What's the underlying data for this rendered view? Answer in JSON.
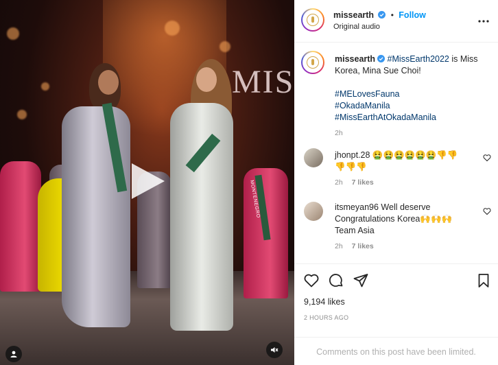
{
  "account": {
    "username": "missearth",
    "verified": true,
    "follow_label": "Follow",
    "audio_label": "Original audio"
  },
  "media": {
    "stage_text": "MISS",
    "sash_text": "MONTENEGRO",
    "play_icon": "play-icon",
    "audio_toggle_icon": "muted-speaker-icon",
    "profile_icon": "user-icon"
  },
  "caption": {
    "username": "missearth",
    "text_before": "is Miss Korea, Mina Sue Choi!",
    "lead_hashtag": "#MissEarth2022",
    "hashtags": [
      "#MELovesFauna",
      "#OkadaManila",
      "#MissEarthAtOkadaManila"
    ],
    "age": "2h"
  },
  "comments": [
    {
      "username": "jhonpt.28",
      "emoji_line_1": "🤮🤮🤮🤮🤮🤮👎👎",
      "emoji_line_2": "👎👎👎",
      "age": "2h",
      "likes": "7 likes"
    },
    {
      "username": "itsmeyan96",
      "line_1": "Well deserve",
      "line_2": "Congratulations Korea🙌🙌🙌",
      "line_3": "Team Asia",
      "age": "2h",
      "likes": "7 likes"
    }
  ],
  "engagement": {
    "likes": "9,194 likes",
    "timestamp": "2 HOURS AGO",
    "limited_notice": "Comments on this post have been limited."
  },
  "colors": {
    "link_blue": "#0095f6",
    "hashtag": "#00376b",
    "muted_gray": "#8e8e8e"
  }
}
